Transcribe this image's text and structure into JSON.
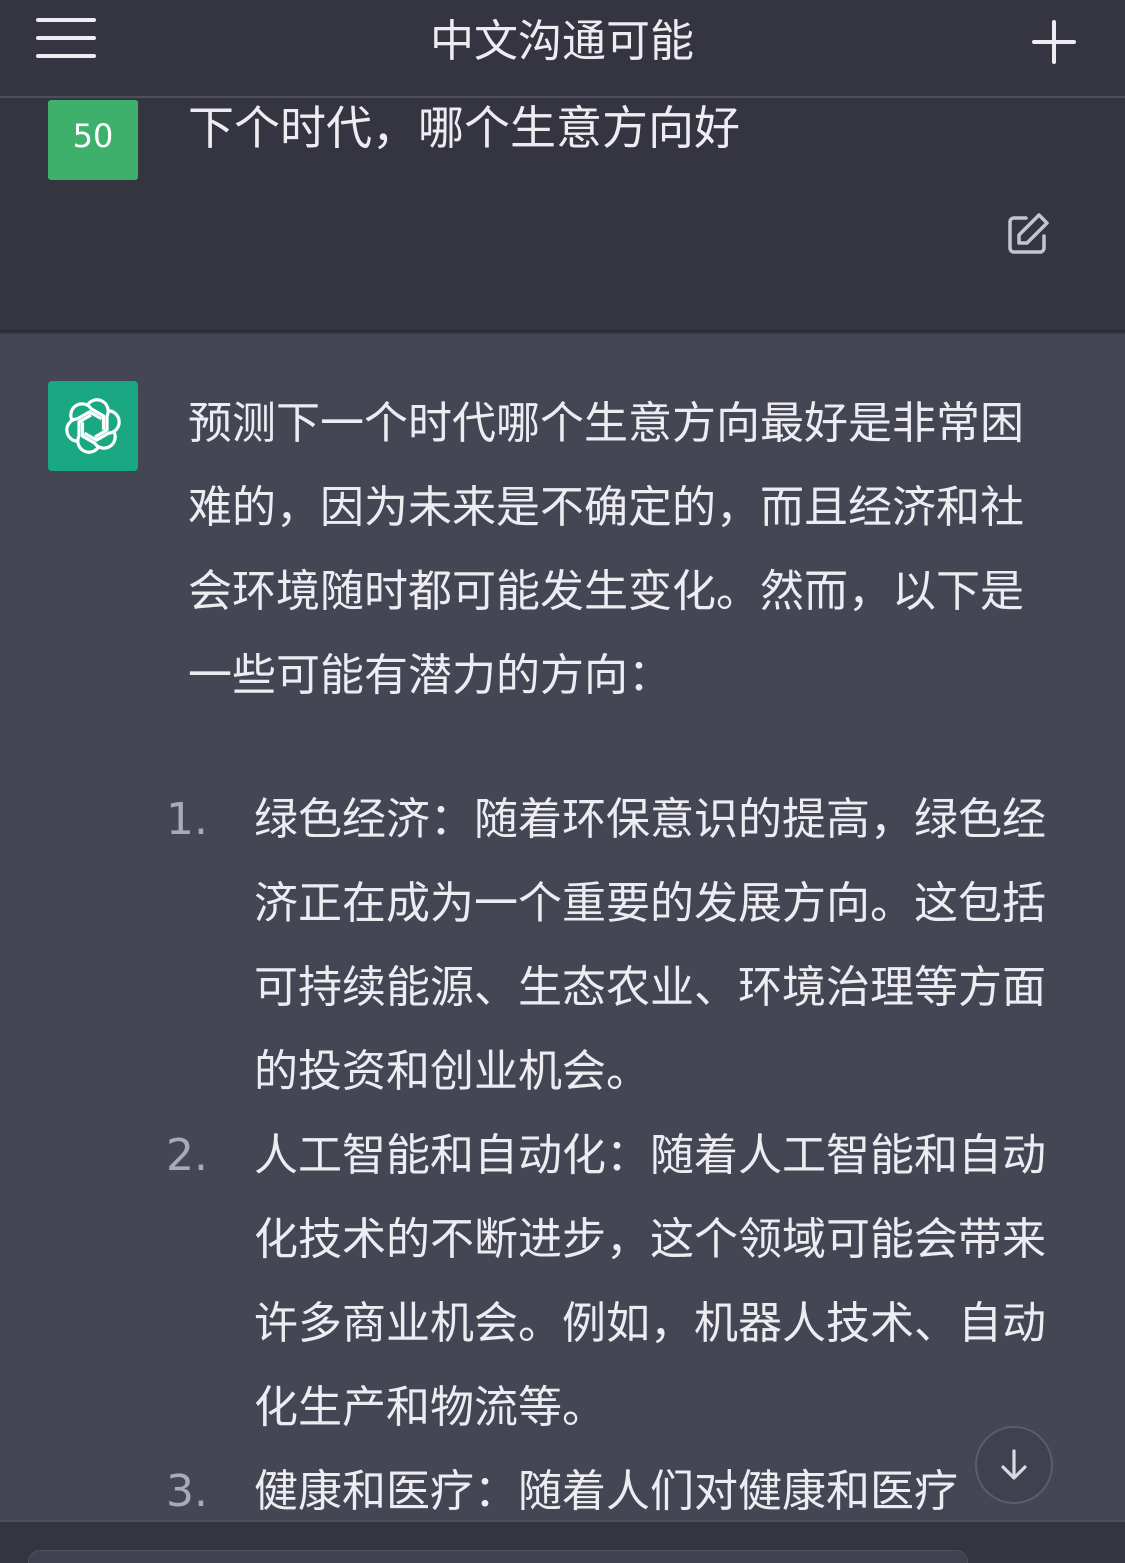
{
  "header": {
    "title": "中文沟通可能"
  },
  "user_message": {
    "avatar_text": "50",
    "text": "下个时代，哪个生意方向好"
  },
  "assistant_message": {
    "intro": "预测下一个时代哪个生意方向最好是非常困难的，因为未来是不确定的，而且经济和社会环境随时都可能发生变化。然而，以下是一些可能有潜力的方向：",
    "items": [
      {
        "num": "1.",
        "text": "绿色经济：随着环保意识的提高，绿色经济正在成为一个重要的发展方向。这包括可持续能源、生态农业、环境治理等方面的投资和创业机会。"
      },
      {
        "num": "2.",
        "text": "人工智能和自动化：随着人工智能和自动化技术的不断进步，这个领域可能会带来许多商业机会。例如，机器人技术、自动化生产和物流等。"
      },
      {
        "num": "3.",
        "text": "健康和医疗：随着人们对健康和医疗"
      }
    ]
  },
  "icons": {
    "menu": "hamburger-menu-icon",
    "new_chat": "plus-icon",
    "edit": "edit-icon",
    "assistant_logo": "openai-logo-icon",
    "scroll_down": "arrow-down-icon"
  },
  "colors": {
    "background": "#343541",
    "assistant_background": "#444654",
    "user_avatar": "#3fb06b",
    "assistant_avatar": "#19a882",
    "text": "#ececf1"
  }
}
